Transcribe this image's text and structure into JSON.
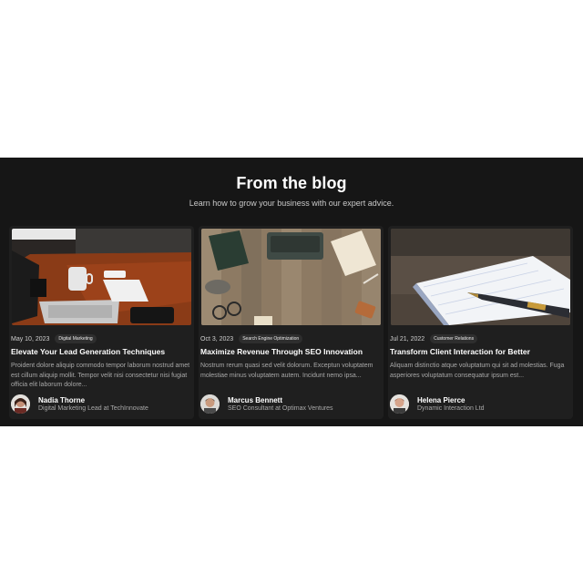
{
  "section": {
    "title": "From the blog",
    "subtitle": "Learn how to grow your business with our expert advice."
  },
  "posts": [
    {
      "date": "May 10, 2023",
      "category": "Digital Marketing",
      "title": "Elevate Your Lead Generation Techniques",
      "excerpt": "Proident dolore aliquip commodo tempor laborum nostrud amet est cillum aliquip mollit. Tempor velit nisi consectetur nisi fugiat officia elit laborum dolore...",
      "author": {
        "name": "Nadia Thorne",
        "role": "Digital Marketing Lead at TechInnovate"
      },
      "image": "desk-laptop-coffee-photo"
    },
    {
      "date": "Oct 3, 2023",
      "category": "Search Engine Optimization",
      "title": "Maximize Revenue Through SEO Innovation",
      "excerpt": "Nostrum rerum quasi sed velit dolorum. Exceptun voluptatem molestiae minus voluptatem autem. Incidunt nemo ipsa...",
      "author": {
        "name": "Marcus Bennett",
        "role": "SEO Consultant at Optimax Ventures"
      },
      "image": "wooden-desk-flatlay-photo"
    },
    {
      "date": "Jul 21, 2022",
      "category": "Customer Relations",
      "title": "Transform Client Interaction for Better",
      "excerpt": "Aliquam distinctio atque voluptatum qui sit ad molestias. Fuga asperiores voluptatum consequatur ipsum est...",
      "author": {
        "name": "Helena Pierce",
        "role": "Dynamic Interaction Ltd"
      },
      "image": "notebook-fountain-pen-photo"
    }
  ]
}
